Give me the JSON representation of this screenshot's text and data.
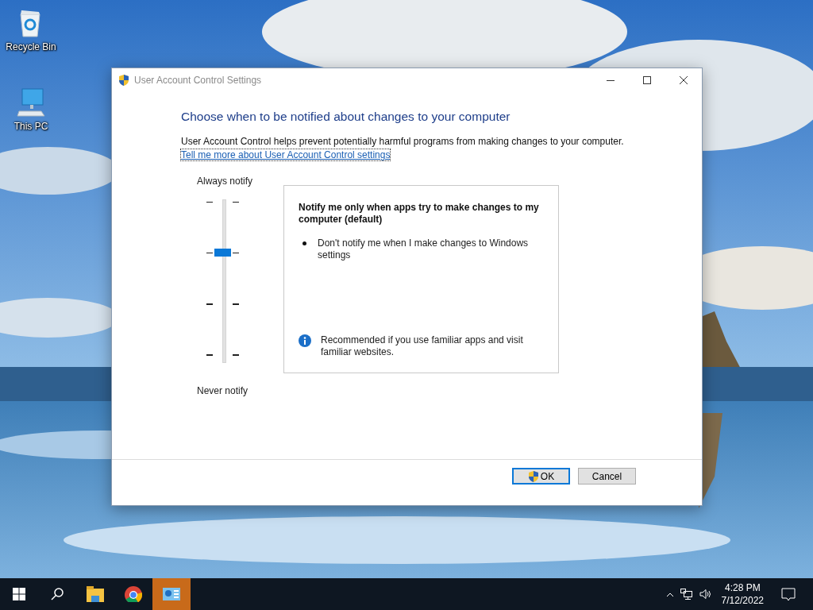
{
  "desktop_icons": [
    {
      "label": "Recycle Bin",
      "kind": "recycle"
    },
    {
      "label": "This PC",
      "kind": "pc"
    }
  ],
  "window": {
    "title": "User Account Control Settings",
    "heading": "Choose when to be notified about changes to your computer",
    "description": "User Account Control helps prevent potentially harmful programs from making changes to your computer.",
    "link": "Tell me more about User Account Control settings",
    "slider": {
      "top_label": "Always notify",
      "bottom_label": "Never notify",
      "level": 0.667
    },
    "panel": {
      "title": "Notify me only when apps try to make changes to my computer (default)",
      "bullets": [
        "Don't notify me when I make changes to Windows settings"
      ],
      "note": "Recommended if you use familiar apps and visit familiar websites."
    },
    "buttons": [
      {
        "label": "OK",
        "kind": "shield",
        "default": true
      },
      {
        "label": "Cancel",
        "kind": "plain",
        "default": false
      }
    ]
  },
  "taskbar": {
    "items": [
      {
        "kind": "start",
        "selected": false
      },
      {
        "kind": "search",
        "selected": false
      },
      {
        "kind": "folder",
        "selected": false
      },
      {
        "kind": "browser",
        "selected": false
      },
      {
        "kind": "control",
        "selected": true
      }
    ],
    "time": "4:28 PM",
    "date": "7/12/2022"
  }
}
